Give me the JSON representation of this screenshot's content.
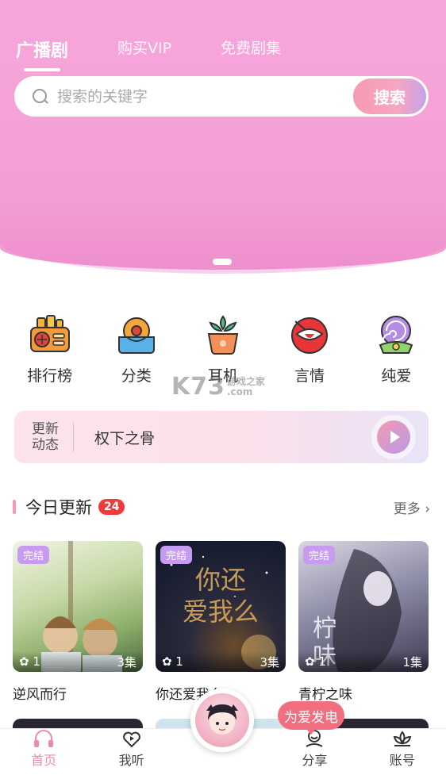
{
  "header": {
    "tabs": [
      {
        "label": "广播剧",
        "active": true
      },
      {
        "label": "购买VIP",
        "active": false
      },
      {
        "label": "免费剧集",
        "active": false
      }
    ]
  },
  "search": {
    "placeholder": "搜索的关键字",
    "button_label": "搜索"
  },
  "categories": [
    {
      "label": "排行榜",
      "icon": "radio-icon"
    },
    {
      "label": "分类",
      "icon": "folder-icon"
    },
    {
      "label": "耳机",
      "icon": "succulent-icon"
    },
    {
      "label": "言情",
      "icon": "lips-icon"
    },
    {
      "label": "纯爱",
      "icon": "lollipop-icon"
    }
  ],
  "watermark": {
    "brand": "K73",
    "site_line1": "游戏之家",
    "site_line2": ".com"
  },
  "news": {
    "tag_line1": "更新",
    "tag_line2": "动态",
    "text": "权下之骨"
  },
  "today": {
    "title": "今日更新",
    "count": "24",
    "more_label": "更多"
  },
  "cards": [
    {
      "status": "完结",
      "plays": "1",
      "episodes": "3集",
      "title": "逆风而行"
    },
    {
      "status": "完结",
      "plays": "1",
      "episodes": "3集",
      "title": "你还爱我么"
    },
    {
      "status": "完结",
      "plays": "1",
      "episodes": "1集",
      "title": "青柠之味"
    }
  ],
  "charge_button": "为爱发电",
  "tabbar": [
    {
      "label": "首页",
      "icon": "headphones-icon",
      "active": true
    },
    {
      "label": "我听",
      "icon": "heart-play-icon",
      "active": false
    },
    {
      "label": "分享",
      "icon": "share-icon",
      "active": false
    },
    {
      "label": "账号",
      "icon": "lotus-icon",
      "active": false
    }
  ],
  "colors": {
    "hero_pink": "#f6a6db",
    "accent_pink": "#f28aa4",
    "badge_red": "#f03b3b",
    "tag_purple": "#c69bf0",
    "charge_red": "#f16f7f"
  }
}
